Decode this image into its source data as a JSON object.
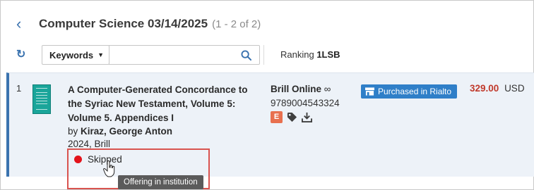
{
  "header": {
    "back_icon": "chevron-left-icon",
    "title": "Computer Science 03/14/2025",
    "count": "(1 - 2 of 2)"
  },
  "toolbar": {
    "refresh_icon": "refresh-icon",
    "search_type": "Keywords",
    "search_value": "",
    "search_icon": "search-icon",
    "ranking_label": "Ranking",
    "ranking_value": "1LSB"
  },
  "results": [
    {
      "index": "1",
      "title": "A Computer-Generated Concordance to the Syriac New Testament, Volume 5: Volume 5. Appendices I",
      "author_prefix": "by",
      "author": "Kiraz, George Anton",
      "publication": "2024, Brill",
      "platform": "Brill Online",
      "platform_icon": "infinity-icon",
      "isbn": "9789004543324",
      "format_badge": "E",
      "badge_color": "#e8704f",
      "purchased_label": "Purchased in Rialto",
      "price": "329.00",
      "currency": "USD",
      "status": "Skipped",
      "status_color": "#e3131b",
      "tooltip": "Offering in institution"
    }
  ],
  "accent_color": "#3b73af"
}
